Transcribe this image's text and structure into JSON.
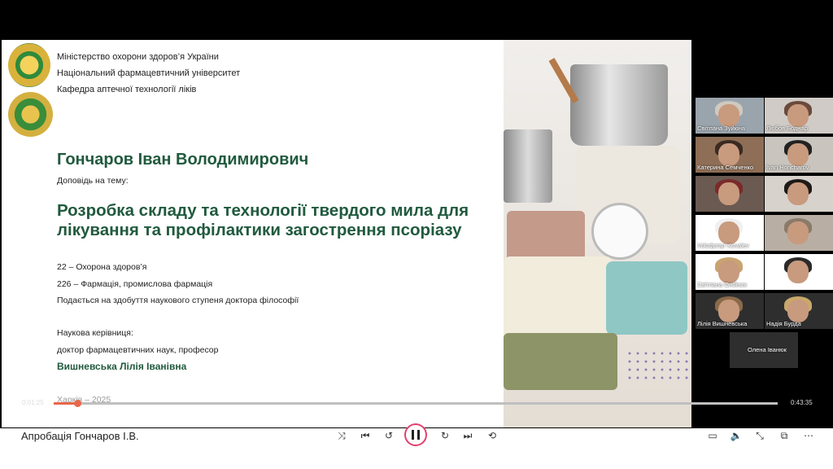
{
  "slide": {
    "header_lines": [
      "Міністерство охорони здоров’я України",
      "Національний фармацевтичний університет",
      "Кафедра аптечної технології ліків"
    ],
    "author": "Гончаров Іван Володимирович",
    "report_label": "Доповідь на тему:",
    "topic": "Розробка складу та технології твердого мила для лікування та профілактики загострення псоріазу",
    "specialties": [
      "22 – Охорона здоров’я",
      "226 – Фармація, промислова фармація",
      "Подається на здобуття наукового ступеня доктора філософії"
    ],
    "supervisor_label": "Наукова керівниця:",
    "supervisor_title": "доктор фармацевтичних наук, професор",
    "supervisor_name": "Вишневська Лілія Іванівна",
    "city_year": "Харків – 2025"
  },
  "participants": [
    {
      "name": "Світлана Зуйкіна",
      "hair": "#cfc9c0",
      "bg": "#9aa4ad"
    },
    {
      "name": "Любов Боднар",
      "hair": "#6a4a3a",
      "bg": "#d0cbc6"
    },
    {
      "name": "Катерина Семченко",
      "hair": "#3a2a22",
      "bg": "#8e6e56"
    },
    {
      "name": "Ivan Honcharov",
      "hair": "#222",
      "bg": "#c9c4bd"
    },
    {
      "name": "",
      "hair": "#7a2a2a",
      "bg": "#6b5a52"
    },
    {
      "name": "",
      "hair": "#1e1a18",
      "bg": "#d7d2cc"
    },
    {
      "name": "Volodymyr Kovalev",
      "hair": "#f0f0f0",
      "bg": "#ffffff"
    },
    {
      "name": "",
      "hair": "#8a7a6a",
      "bg": "#b8aea3"
    },
    {
      "name": "Світлана Олійник",
      "hair": "#c8a470",
      "bg": "#ffffff"
    },
    {
      "name": "",
      "hair": "#2a2a2a",
      "bg": "#ffffff"
    },
    {
      "name": "Лілія Вишневська",
      "hair": "#8a6a4a",
      "bg": "#2e2e2e"
    },
    {
      "name": "Надія Бурда",
      "hair": "#c9a86a",
      "bg": "#2e2e2e"
    },
    {
      "name": "Олена Іванюк",
      "hair": "#2e2e2e",
      "bg": "#2e2e2e"
    }
  ],
  "player": {
    "elapsed": "0:01:25",
    "total": "0:43:35",
    "progress": 0.033,
    "title": "Апробація Гончаров І.В.",
    "accent": "#e8684a"
  }
}
